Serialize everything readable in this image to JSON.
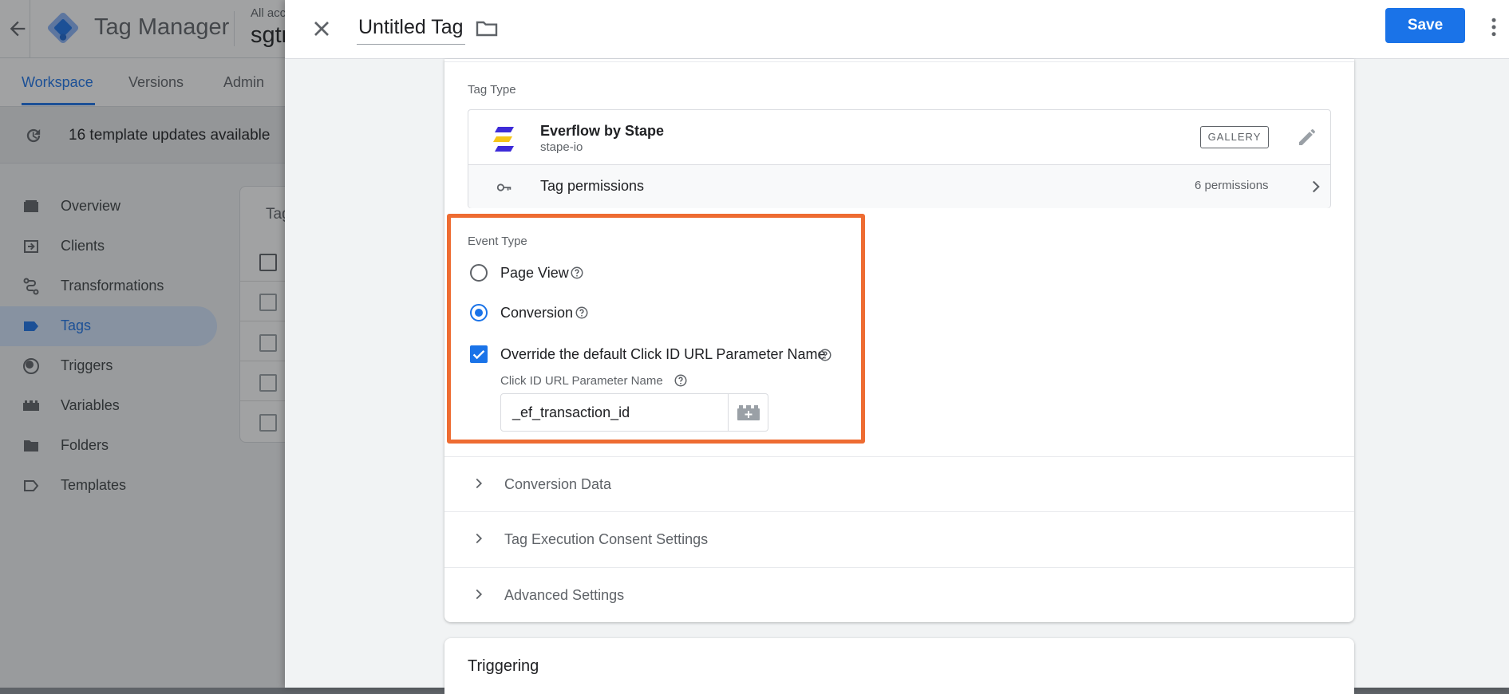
{
  "background": {
    "app_name": "Tag Manager",
    "account_label": "All acc",
    "container_name": "sgtr",
    "nav_tabs": [
      "Workspace",
      "Versions",
      "Admin"
    ],
    "updates_text": "16 template updates available",
    "sidebar": [
      {
        "label": "Overview",
        "icon": "overview-icon"
      },
      {
        "label": "Clients",
        "icon": "clients-icon"
      },
      {
        "label": "Transformations",
        "icon": "transformations-icon"
      },
      {
        "label": "Tags",
        "icon": "tag-icon",
        "active": true
      },
      {
        "label": "Triggers",
        "icon": "triggers-icon"
      },
      {
        "label": "Variables",
        "icon": "variables-icon"
      },
      {
        "label": "Folders",
        "icon": "folder-icon"
      },
      {
        "label": "Templates",
        "icon": "templates-icon"
      }
    ],
    "card_title": "Tag"
  },
  "header": {
    "tag_name": "Untitled Tag",
    "save_label": "Save"
  },
  "tag_config": {
    "tag_type_label": "Tag Type",
    "template_name": "Everflow by Stape",
    "template_vendor": "stape-io",
    "gallery_badge": "GALLERY",
    "permissions_label": "Tag permissions",
    "permissions_count": "6 permissions",
    "event_type": {
      "label": "Event Type",
      "options": [
        {
          "label": "Page View",
          "selected": false
        },
        {
          "label": "Conversion",
          "selected": true
        }
      ],
      "override_label": "Override the default Click ID URL Parameter Name",
      "override_checked": true,
      "param_label": "Click ID URL Parameter Name",
      "param_value": "_ef_transaction_id"
    },
    "sections": [
      "Conversion Data",
      "Tag Execution Consent Settings",
      "Advanced Settings"
    ]
  },
  "triggering": {
    "title": "Triggering"
  },
  "colors": {
    "accent": "#1a73e8",
    "highlight": "#ee6c32"
  }
}
